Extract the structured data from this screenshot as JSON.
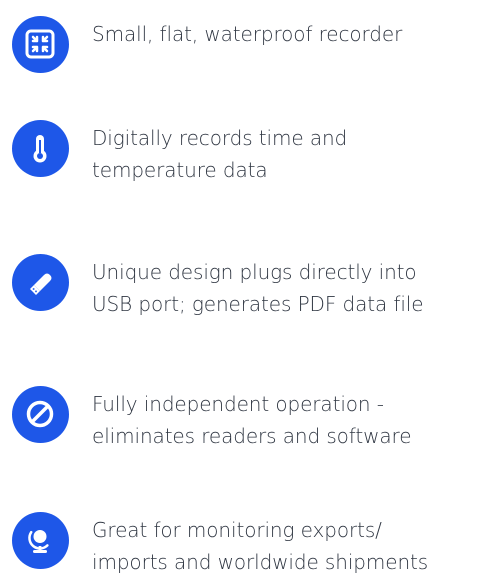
{
  "colors": {
    "accent": "#1e57e8",
    "text": "#2f3642",
    "background": "#ffffff"
  },
  "features": [
    {
      "icon": "compress-icon",
      "lines": [
        "Small, flat, waterproof recorder"
      ]
    },
    {
      "icon": "thermometer-icon",
      "lines": [
        "Digitally records time and",
        "temperature data"
      ]
    },
    {
      "icon": "usb-drive-icon",
      "lines": [
        "Unique design plugs directly into",
        "USB port; generates PDF data file"
      ]
    },
    {
      "icon": "ban-icon",
      "lines": [
        "Fully independent operation -",
        "eliminates readers and software"
      ]
    },
    {
      "icon": "globe-icon",
      "lines": [
        "Great for monitoring exports/",
        "imports and worldwide shipments"
      ]
    }
  ]
}
